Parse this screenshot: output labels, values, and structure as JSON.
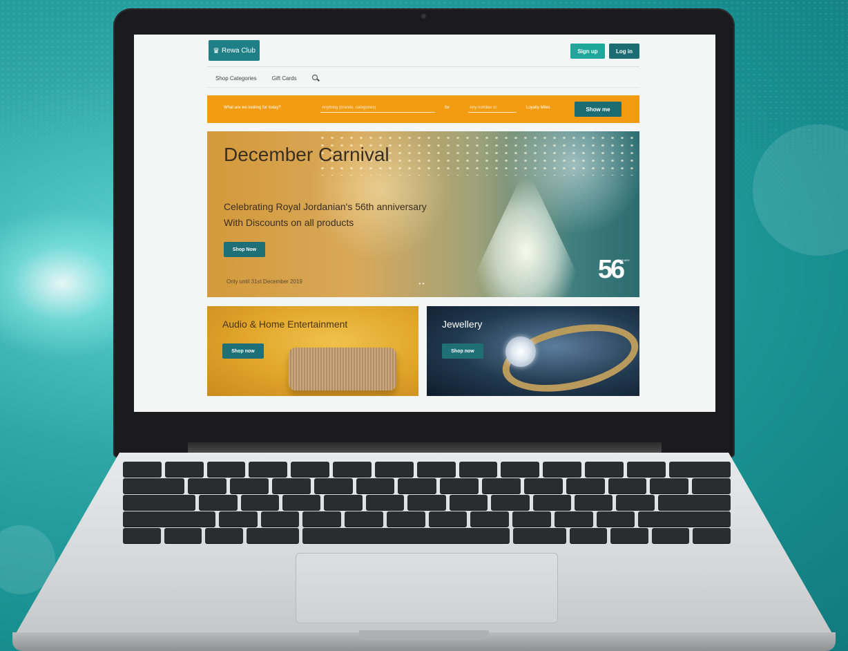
{
  "site": {
    "logo_text": "Rewa Club",
    "signup_label": "Sign up",
    "login_label": "Log in",
    "nav": {
      "shop_categories": "Shop Categories",
      "gift_cards": "Gift Cards"
    },
    "searchbar": {
      "prompt": "What are we looking for today?",
      "field_placeholder": "Anything (brands, categories)",
      "for_label": "for",
      "any_placeholder": "Any number of",
      "points_label": "Loyalty Miles",
      "show_label": "Show me"
    },
    "hero": {
      "title": "December Carnival",
      "subtitle_line1": "Celebrating Royal Jordanian's 56th anniversary",
      "subtitle_line2": "With Discounts on all products",
      "button": "Shop Now",
      "note": "Only until 31st December 2019",
      "badge": "56",
      "badge_years": "YEARS"
    },
    "cards": [
      {
        "title": "Audio & Home Entertainment",
        "button": "Shop now"
      },
      {
        "title": "Jewellery",
        "button": "Shop now"
      }
    ]
  },
  "colors": {
    "brand_teal": "#1b6d73",
    "accent_teal": "#21a69b",
    "banner_orange": "#f39c12"
  }
}
